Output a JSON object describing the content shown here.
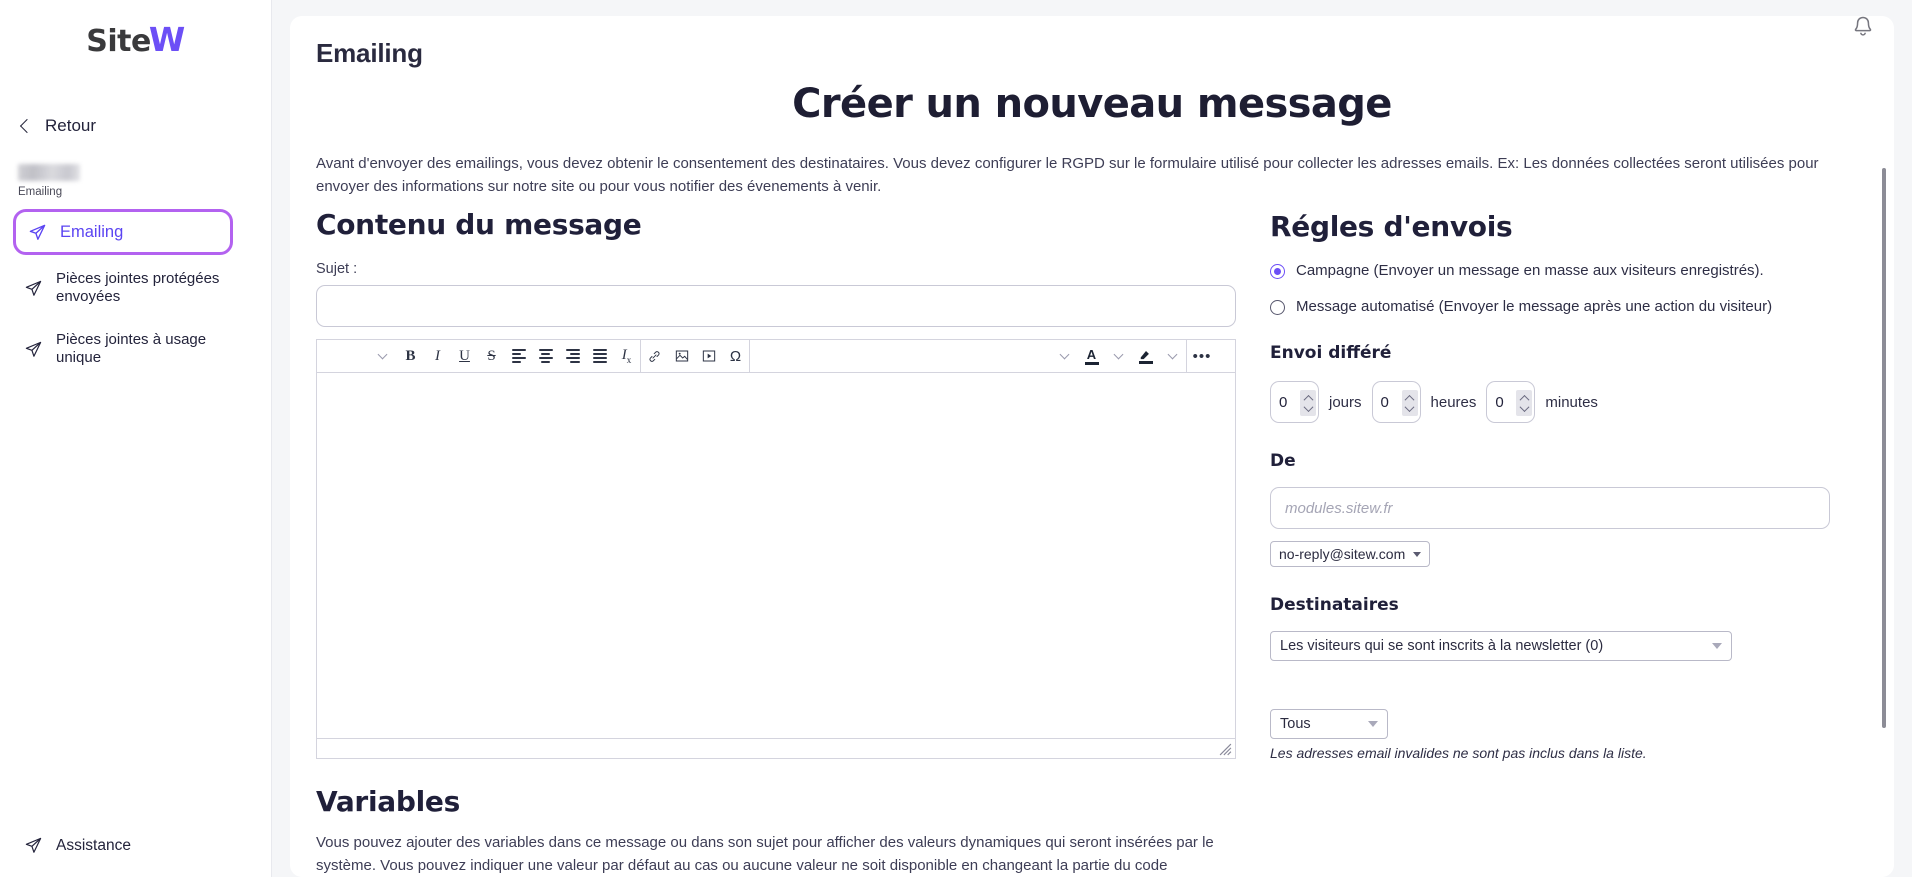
{
  "brand": {
    "name_dark": "Site",
    "name_accent": "W",
    "accent_color": "#6c4ff6"
  },
  "sidebar": {
    "back_label": "Retour",
    "site_caption": "Emailing",
    "items": [
      {
        "label": "Emailing",
        "icon": "paper-plane-icon",
        "active": true
      },
      {
        "label": "Pièces jointes protégées envoyées",
        "icon": "paper-plane-icon",
        "active": false
      },
      {
        "label": "Pièces jointes à usage unique",
        "icon": "paper-plane-icon",
        "active": false
      }
    ],
    "assistance_label": "Assistance",
    "active_border_color": "#b362f0",
    "active_text_color": "#5b44f2"
  },
  "header": {
    "page_title": "Emailing",
    "bell_icon": "notification-bell-icon"
  },
  "main": {
    "big_title": "Créer un nouveau message",
    "intro": "Avant d'envoyer des emailings, vous devez obtenir le consentement des destinataires. Vous devez configurer le RGPD sur le formulaire utilisé pour collecter les adresses emails. Ex: Les données collectées seront utilisées pour envoyer des informations sur notre site ou pour vous notifier des évenements à venir."
  },
  "content_section": {
    "heading": "Contenu du message",
    "subject_label": "Sujet :",
    "subject_value": "",
    "subject_placeholder": "",
    "editor_body_value": "",
    "toolbar": {
      "group1": [
        {
          "name": "paragraph-format-chevron-icon",
          "glyph": "chevron"
        },
        {
          "name": "bold-button",
          "glyph": "B"
        },
        {
          "name": "italic-button",
          "glyph": "I"
        },
        {
          "name": "underline-button",
          "glyph": "U"
        },
        {
          "name": "strikethrough-button",
          "glyph": "S"
        },
        {
          "name": "align-left-button",
          "glyph": "align-l"
        },
        {
          "name": "align-center-button",
          "glyph": "align-c"
        },
        {
          "name": "align-right-button",
          "glyph": "align-r"
        },
        {
          "name": "align-justify-button",
          "glyph": "align-j"
        },
        {
          "name": "remove-format-button",
          "glyph": "Ix"
        }
      ],
      "group2": [
        {
          "name": "insert-link-button",
          "glyph": "link"
        },
        {
          "name": "insert-image-button",
          "glyph": "image"
        },
        {
          "name": "insert-video-button",
          "glyph": "video"
        },
        {
          "name": "special-character-button",
          "glyph": "Ω"
        }
      ],
      "group3": [
        {
          "name": "text-color-chevron-icon",
          "glyph": "chevron"
        },
        {
          "name": "text-color-button",
          "glyph": "A"
        },
        {
          "name": "text-color-dropdown-chevron-icon",
          "glyph": "chevron"
        },
        {
          "name": "highlight-color-button",
          "glyph": "marker"
        },
        {
          "name": "highlight-color-dropdown-chevron-icon",
          "glyph": "chevron"
        }
      ],
      "group4": [
        {
          "name": "more-options-button",
          "glyph": "•••"
        }
      ]
    }
  },
  "variables_section": {
    "heading": "Variables",
    "text": "Vous pouvez ajouter des variables dans ce message ou dans son sujet pour afficher des valeurs dynamiques qui seront insérées par le système. Vous pouvez indiquer une valeur par défaut au cas ou aucune valeur ne soit disponible en changeant la partie du code"
  },
  "rules_section": {
    "heading": "Régles d'envois",
    "options": [
      {
        "label": "Campagne (Envoyer un message en masse aux visiteurs enregistrés).",
        "selected": true
      },
      {
        "label": "Message automatisé (Envoyer le message après une action du visiteur)",
        "selected": false
      }
    ],
    "delay": {
      "heading": "Envoi différé",
      "fields": [
        {
          "value": "0",
          "unit": "jours"
        },
        {
          "value": "0",
          "unit": "heures"
        },
        {
          "value": "0",
          "unit": "minutes"
        }
      ]
    },
    "from": {
      "heading": "De",
      "domain_value": "",
      "domain_placeholder": "modules.sitew.fr",
      "address_selected": "no-reply@sitew.com"
    },
    "recipients": {
      "heading": "Destinataires",
      "list_selected": "Les visiteurs qui se sont inscrits à la newsletter (0)",
      "filter_selected": "Tous",
      "note": "Les adresses email invalides ne sont pas inclus dans la liste."
    }
  }
}
